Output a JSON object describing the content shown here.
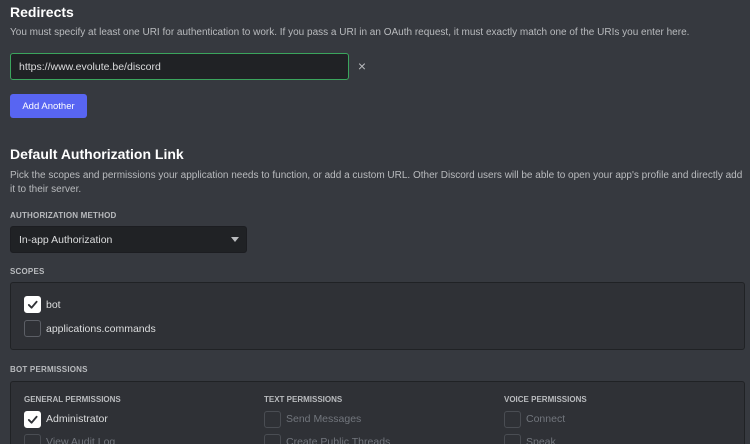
{
  "redirects": {
    "title": "Redirects",
    "description": "You must specify at least one URI for authentication to work. If you pass a URI in an OAuth request, it must exactly match one of the URIs you enter here.",
    "uri_value": "https://www.evolute.be/discord",
    "remove_glyph": "×",
    "add_button": "Add Another"
  },
  "default_auth": {
    "title": "Default Authorization Link",
    "description": "Pick the scopes and permissions your application needs to function, or add a custom URL. Other Discord users will be able to open your app's profile and directly add it to their server.",
    "method_label": "AUTHORIZATION METHOD",
    "method_value": "In-app Authorization"
  },
  "scopes": {
    "label": "SCOPES",
    "items": [
      {
        "label": "bot",
        "checked": true
      },
      {
        "label": "applications.commands",
        "checked": false
      }
    ]
  },
  "bot_permissions": {
    "label": "BOT PERMISSIONS",
    "columns": [
      {
        "header": "GENERAL PERMISSIONS",
        "items": [
          {
            "label": "Administrator",
            "checked": true
          },
          {
            "label": "View Audit Log",
            "checked": false
          }
        ]
      },
      {
        "header": "TEXT PERMISSIONS",
        "items": [
          {
            "label": "Send Messages",
            "checked": false
          },
          {
            "label": "Create Public Threads",
            "checked": false
          }
        ]
      },
      {
        "header": "VOICE PERMISSIONS",
        "items": [
          {
            "label": "Connect",
            "checked": false
          },
          {
            "label": "Speak",
            "checked": false
          }
        ]
      }
    ]
  },
  "colors": {
    "background": "#36393f",
    "accent": "#5865f2",
    "input_focus": "#3ba55d"
  },
  "icons": {
    "remove": "close-icon",
    "dropdown": "chevron-down-icon",
    "check": "checkmark-icon"
  }
}
